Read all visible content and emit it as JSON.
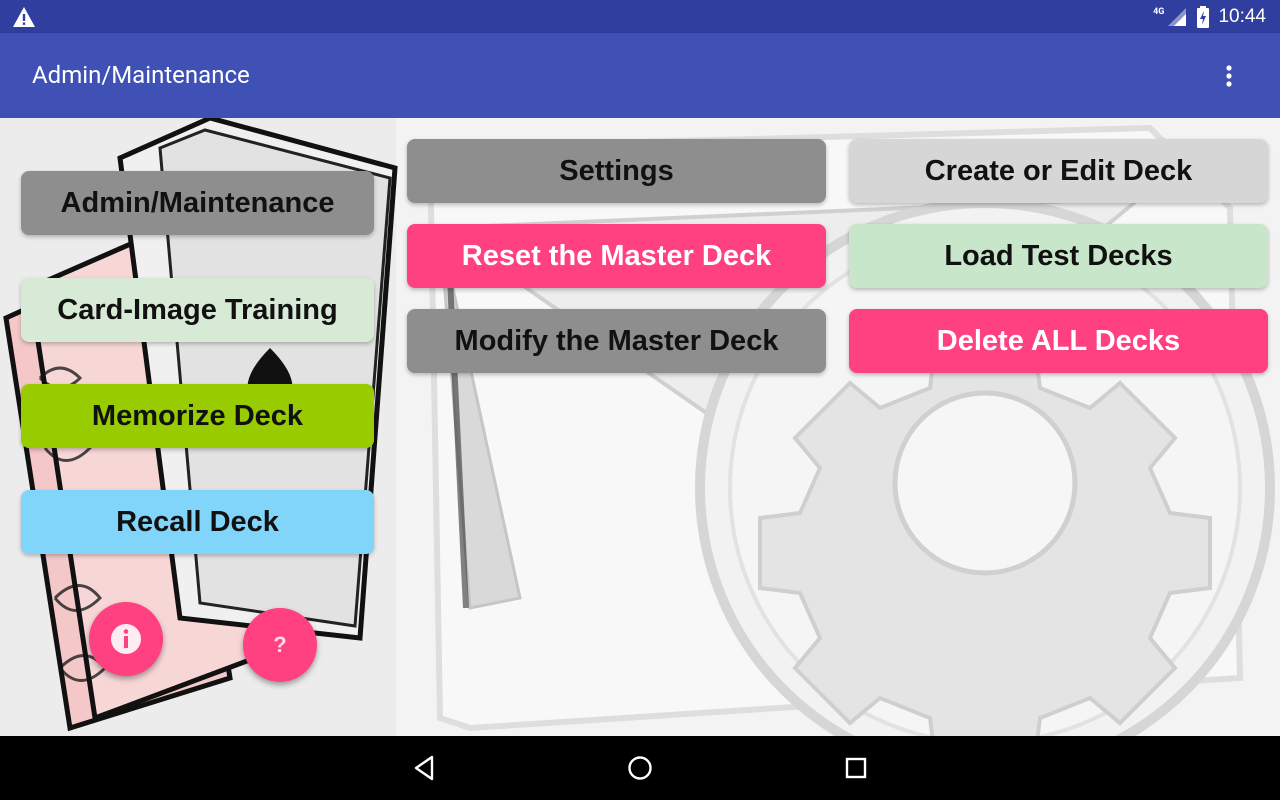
{
  "status_bar": {
    "network": "4G",
    "time": "10:44",
    "icons": [
      "warning-icon",
      "signal-icon",
      "battery-icon"
    ]
  },
  "app_bar": {
    "title": "Admin/Maintenance",
    "menu_icon": "overflow-menu-icon"
  },
  "left_menu": {
    "admin_label": "Admin/Maintenance",
    "card_image_label": "Card-Image Training",
    "memorize_label": "Memorize Deck",
    "recall_label": "Recall Deck"
  },
  "actions": {
    "settings_label": "Settings",
    "create_edit_label": "Create or Edit Deck",
    "reset_master_label": "Reset the Master Deck",
    "load_test_label": "Load Test Decks",
    "modify_master_label": "Modify the Master Deck",
    "delete_all_label": "Delete ALL Decks"
  },
  "fabs": {
    "info_icon": "info-icon",
    "help_label": "?"
  },
  "nav_bar": {
    "icons": [
      "back-icon",
      "home-icon",
      "recents-icon"
    ]
  },
  "colors": {
    "primary": "#3F51B5",
    "primary_dark": "#303F9F",
    "accent_pink": "#FF4081",
    "gray": "#8E8E8E",
    "lime": "#99CC00",
    "sky": "#81D4FA",
    "mint": "#C8E6C9"
  }
}
